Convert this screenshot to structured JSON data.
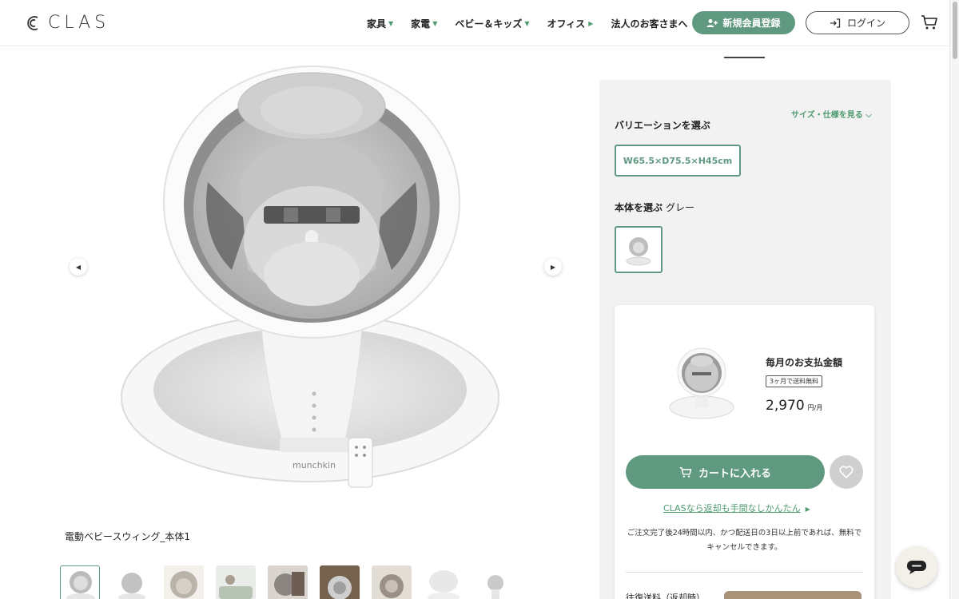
{
  "brand": {
    "name": "CLAS"
  },
  "header": {
    "nav": [
      {
        "label": "家具",
        "icon": "caret-down-icon"
      },
      {
        "label": "家電",
        "icon": "caret-down-icon"
      },
      {
        "label": "ベビー＆キッズ",
        "icon": "caret-down-icon"
      },
      {
        "label": "オフィス",
        "icon": "caret-right-icon"
      },
      {
        "label": "法人のお客さまへ",
        "icon": ""
      }
    ],
    "register_label": "新規会員登録",
    "login_label": "ログイン"
  },
  "gallery": {
    "caption": "電動ベビースウィング_本体1",
    "thumbnail_count": 9,
    "active_index": 0
  },
  "options": {
    "size_link": "サイズ・仕様を見る",
    "variation_label": "バリエーションを選ぶ",
    "variation_value": "W65.5×D75.5×H45cm",
    "body_label": "本体を選ぶ",
    "body_selected": "グレー"
  },
  "purchase": {
    "monthly_label": "毎月のお支払金額",
    "shipping_badge": "3ヶ月で送料無料",
    "price": "2,970",
    "price_unit": "円/月",
    "cart_button": "カートに入れる",
    "return_link": "CLASなら返却も手間なしかんたん",
    "note": "ご注文完了後24時間以内、かつ配送日の3日以上前であれば、無料でキャンセルできます。",
    "shipping_row": "往復送料（返却時）"
  },
  "colors": {
    "accent": "#5f9a80",
    "accent_text": "#4f9a6f",
    "panel_bg": "#f1f2f1"
  }
}
